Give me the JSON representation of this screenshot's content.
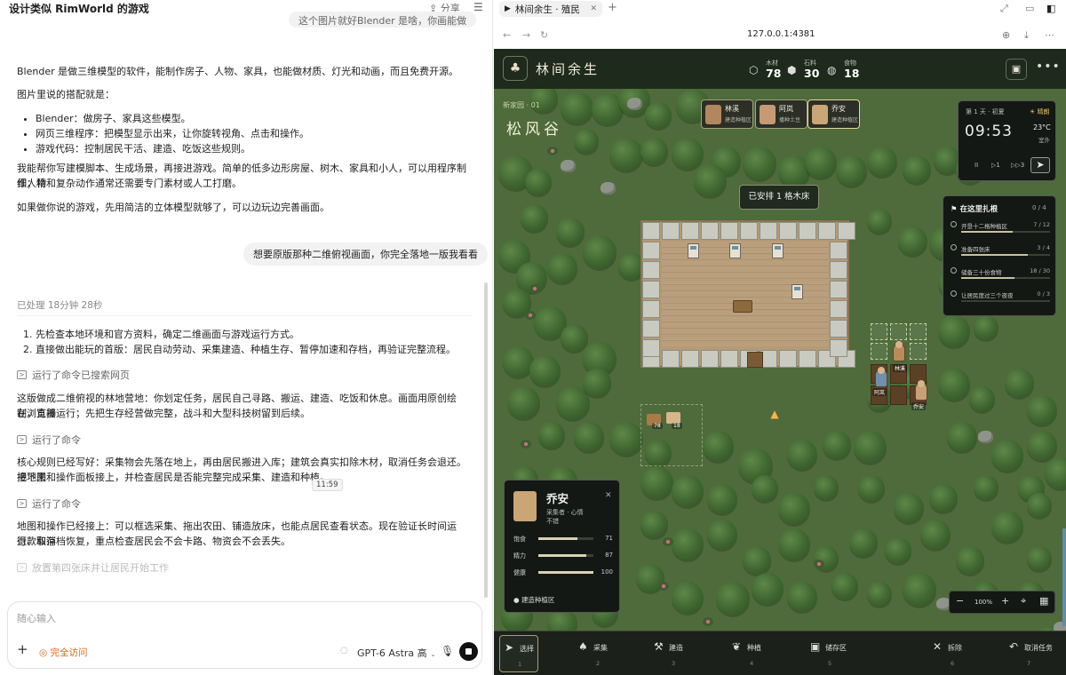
{
  "chat": {
    "title": "设计类似 RimWorld 的游戏",
    "more": "···",
    "share": "分享",
    "top_bubble": "这个图片就好Blender 是啥，你画能做",
    "paragraphs": {
      "p1": "Blender 是做三维模型的软件，能制作房子、人物、家具，也能做材质、灯光和动画，而且免费开源。",
      "p2": "图片里说的搭配就是：",
      "b1": "Blender：做房子、家具这些模型。",
      "b2": "网页三维程序：把模型显示出来，让你旋转视角、点击和操作。",
      "b3": "游戏代码：控制居民干活、建造、吃饭这些规则。",
      "p3a": "我能帮你写建模脚本、生成场景，再接进游戏。简单的低多边形房屋、树木、家具和小人，可以用程序制作；精",
      "p3b": "细人物和复杂动作通常还需要专门素材或人工打磨。",
      "p4": "如果做你说的游戏，先用简洁的立体模型就够了，可以边玩边完善画面。"
    },
    "user_msg": "想要原版那种二维俯视画面，你完全落地一版我看看",
    "processed": "已处理 18分钟 28秒",
    "steps": [
      "先检查本地环境和官方资料，确定二维画面与游戏运行方式。",
      "直接做出能玩的首版：居民自动劳动、采集建造、种植生存、暂停加速和存档，再验证完整流程。"
    ],
    "cmd1": "运行了命令已搜索网页",
    "para5a": "这版做成二维俯视的林地营地：你划定任务，居民自己寻路、搬运、建造、吃饭和休息。画面用原创绘制，直接",
    "para5b": "在浏览器运行；先把生存经营做完整，战斗和大型科技树留到后续。",
    "cmd2": "运行了命令",
    "para6a": "核心规则已经写好：采集物会先落在地上，再由居民搬进入库；建筑会真实扣除木材，取消任务会退还。接下来",
    "para6b": "把地图和操作面板接上，并检查居民是否能完整完成采集、建造和种植。",
    "tooltip": "11:59",
    "cmd3": "运行了命令",
    "para7a": "地图和操作已经接上：可以框选采集、拖出农田、铺造放床，也能点居民查看状态。现在验证长时间运行、取消",
    "para7b": "退款和存档恢复，重点检查居民会不会卡路、物资会不会丢失。",
    "cmd4": "放置第四张床并让居民开始工作",
    "composer": {
      "placeholder": "随心输入",
      "access": "完全访问",
      "model": "GPT-6 Astra 高"
    }
  },
  "browser": {
    "tab_title": "林间余生 · 殖民",
    "url": "127.0.0.1:4381"
  },
  "game": {
    "title": "林间余生",
    "resources": [
      {
        "label": "木材",
        "value": "78",
        "icon": "wood-cube-icon"
      },
      {
        "label": "石料",
        "value": "30",
        "icon": "stone-icon"
      },
      {
        "label": "食物",
        "value": "18",
        "icon": "apple-icon"
      }
    ],
    "location_sub": "新家园 · 01",
    "location": "松风谷",
    "colonists": [
      {
        "name": "林溪",
        "status": "建造种植区"
      },
      {
        "name": "阿岚",
        "status": "播种土豆"
      },
      {
        "name": "乔安",
        "status": "建造种植区"
      }
    ],
    "toast": "已安排 1 格木床",
    "time": {
      "day": "第 1 天 · 初夏",
      "weather": "晴朗",
      "clock": "09:53",
      "temp": "23°C",
      "place": "室外",
      "speeds": [
        "II",
        "▷1",
        "▷▷3"
      ]
    },
    "quests": {
      "title": "在这里扎根",
      "count": "0 / 4",
      "items": [
        {
          "text": "开垦十二格种植区",
          "progress": "7 / 12",
          "ratio": 0.58
        },
        {
          "text": "准备四张床",
          "progress": "3 / 4",
          "ratio": 0.75
        },
        {
          "text": "储备三十份食物",
          "progress": "18 / 30",
          "ratio": 0.6
        },
        {
          "text": "让居民度过三个夜夜",
          "progress": "0 / 3",
          "ratio": 0
        }
      ]
    },
    "map_labels": {
      "farm1": "林溪",
      "farm2": "阿岚",
      "farm3": "乔安",
      "stock1": "78",
      "stock2": "18"
    },
    "selected": {
      "name": "乔安",
      "role": "采集者 · 心情",
      "mood": "不错",
      "stats": [
        {
          "label": "饱食",
          "value": "71",
          "ratio": 0.71
        },
        {
          "label": "精力",
          "value": "87",
          "ratio": 0.87
        },
        {
          "label": "健康",
          "value": "100",
          "ratio": 1.0
        }
      ],
      "task": "建造种植区"
    },
    "zoom": "100%",
    "tools": [
      {
        "label": "选择",
        "key": "1",
        "icon": "cursor-icon"
      },
      {
        "label": "采集",
        "key": "2",
        "icon": "tree-icon"
      },
      {
        "label": "建造",
        "key": "3",
        "icon": "hammer-icon"
      },
      {
        "label": "种植",
        "key": "4",
        "icon": "leaf-icon"
      },
      {
        "label": "储存区",
        "key": "5",
        "icon": "box-icon"
      },
      {
        "label": "拆除",
        "key": "6",
        "icon": "x-icon"
      },
      {
        "label": "取消任务",
        "key": "7",
        "icon": "undo-icon"
      }
    ]
  }
}
